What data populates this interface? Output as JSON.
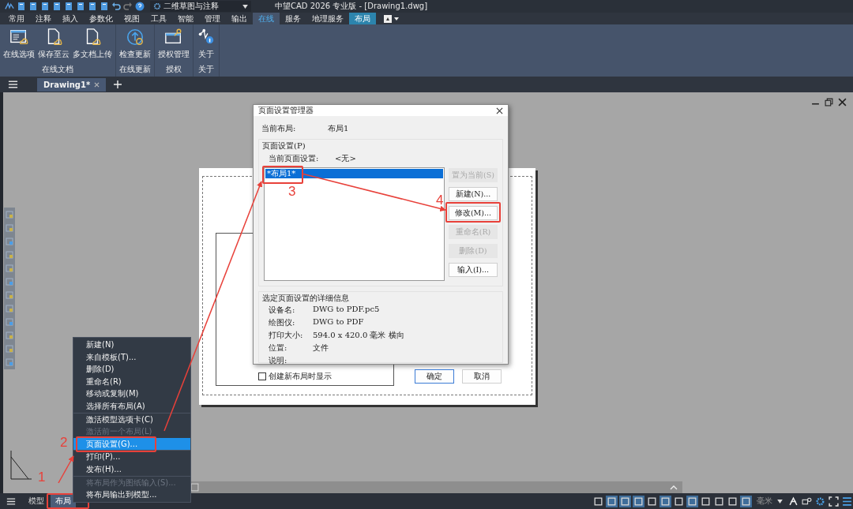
{
  "app": {
    "title": "中望CAD 2026 专业版 - [Drawing1.dwg]",
    "workspace": "二维草图与注释"
  },
  "menu_tabs": [
    {
      "label": "常用",
      "selected": false,
      "kind": "normal"
    },
    {
      "label": "注释",
      "selected": false,
      "kind": "normal"
    },
    {
      "label": "插入",
      "selected": false,
      "kind": "normal"
    },
    {
      "label": "参数化",
      "selected": false,
      "kind": "normal"
    },
    {
      "label": "视图",
      "selected": false,
      "kind": "normal"
    },
    {
      "label": "工具",
      "selected": false,
      "kind": "normal"
    },
    {
      "label": "智能",
      "selected": false,
      "kind": "normal"
    },
    {
      "label": "管理",
      "selected": false,
      "kind": "normal"
    },
    {
      "label": "输出",
      "selected": false,
      "kind": "normal"
    },
    {
      "label": "在线",
      "selected": true,
      "kind": "normal"
    },
    {
      "label": "服务",
      "selected": false,
      "kind": "normal"
    },
    {
      "label": "地理服务",
      "selected": false,
      "kind": "normal"
    },
    {
      "label": "布局",
      "selected": false,
      "kind": "contextual"
    }
  ],
  "ribbon_groups": [
    {
      "label": "在线文档",
      "buttons": [
        "在线选项",
        "保存至云",
        "多文档上传"
      ]
    },
    {
      "label": "在线更新",
      "buttons": [
        "检查更新"
      ]
    },
    {
      "label": "授权",
      "buttons": [
        "授权管理"
      ]
    },
    {
      "label": "关于",
      "buttons": [
        "关于"
      ]
    }
  ],
  "document_tabs": [
    {
      "label": "Drawing1*",
      "selected": true
    }
  ],
  "dialog": {
    "title": "页面设置管理器",
    "current_layout_label": "当前布局:",
    "current_layout": "布局1",
    "group_label": "页面设置(P)",
    "current_setup_label": "当前页面设置:",
    "current_setup": "<无>",
    "list": [
      {
        "label": "*布局1*",
        "selected": true
      }
    ],
    "side_buttons": [
      {
        "label": "置为当前(S)",
        "disabled": true
      },
      {
        "label": "新建(N)...",
        "disabled": false
      },
      {
        "label": "修改(M)...",
        "disabled": false
      },
      {
        "label": "重命名(R)",
        "disabled": true
      },
      {
        "label": "删除(D)",
        "disabled": true
      },
      {
        "label": "输入(I)...",
        "disabled": false
      }
    ],
    "details_label": "选定页面设置的详细信息",
    "details": [
      {
        "label": "设备名:",
        "value": "DWG to PDF.pc5"
      },
      {
        "label": "绘图仪:",
        "value": "DWG to PDF"
      },
      {
        "label": "打印大小:",
        "value": "594.0 x 420.0 毫米 横向"
      },
      {
        "label": "位置:",
        "value": "文件"
      },
      {
        "label": "说明:"
      }
    ],
    "show_on_new": {
      "label": "创建新布局时显示",
      "checked": false
    },
    "buttons": [
      "确定",
      "取消"
    ]
  },
  "context_menu": [
    {
      "label": "新建(N)",
      "disabled": false,
      "selected": false
    },
    {
      "label": "来自模板(T)...",
      "disabled": false,
      "selected": false
    },
    {
      "label": "删除(D)",
      "disabled": false,
      "selected": false
    },
    {
      "label": "重命名(R)",
      "disabled": false,
      "selected": false
    },
    {
      "label": "移动或复制(M)",
      "disabled": false,
      "selected": false
    },
    {
      "label": "选择所有布局(A)",
      "disabled": false,
      "selected": false
    },
    {
      "label": "激活模型选项卡(C)",
      "disabled": false,
      "selected": false
    },
    {
      "label": "激活前一个布局(L)",
      "disabled": true,
      "selected": false
    },
    {
      "label": "页面设置(G)...",
      "disabled": false,
      "selected": true
    },
    {
      "label": "打印(P)...",
      "disabled": false,
      "selected": false
    },
    {
      "label": "发布(H)...",
      "disabled": false,
      "selected": false
    },
    {
      "label": "将布局作为图纸输入(S)...",
      "disabled": true,
      "selected": false
    },
    {
      "label": "将布局输出到模型...",
      "disabled": false,
      "selected": false
    }
  ],
  "layout_tabs": [
    {
      "label": "模型",
      "selected": false
    },
    {
      "label": "布局",
      "selected": true
    }
  ],
  "status_bar": {
    "units": "毫米",
    "toggles": [
      {
        "on": false
      },
      {
        "on": true
      },
      {
        "on": true
      },
      {
        "on": true
      },
      {
        "on": false
      },
      {
        "on": true
      },
      {
        "on": false
      },
      {
        "on": true
      },
      {
        "on": false
      },
      {
        "on": false
      },
      {
        "on": false
      },
      {
        "on": true
      }
    ]
  },
  "annotations": [
    "1",
    "2",
    "3",
    "4"
  ]
}
